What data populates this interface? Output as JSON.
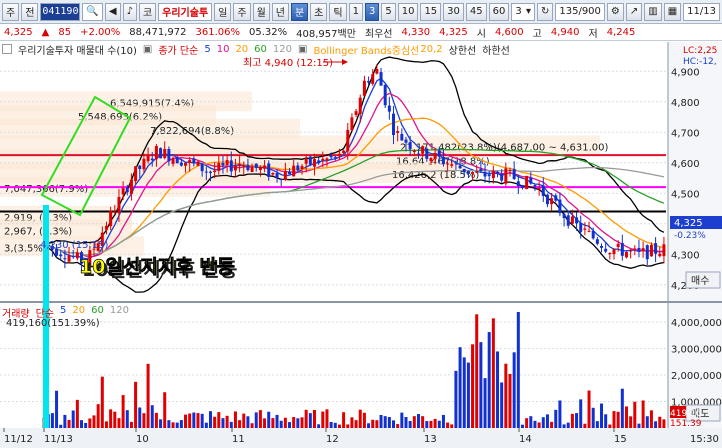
{
  "toolbar": {
    "stock_code": "041190",
    "stock_name": "우리기술투",
    "period_tabs": [
      "일",
      "주",
      "월",
      "년",
      "분",
      "초",
      "틱"
    ],
    "minute_options": [
      "1",
      "3",
      "5",
      "10",
      "15",
      "30",
      "45",
      "60"
    ],
    "selected_period": "분",
    "selected_minute": "3",
    "interval_value": "3",
    "count_display": "135/900",
    "date_label": "11/13",
    "item_labels": [
      "주",
      "전",
      "코"
    ]
  },
  "quote": {
    "price": "4,325",
    "change": "85",
    "change_pct": "+2.00%",
    "volume": "88,471,972",
    "volume_ratio": "361.06%",
    "turnover_pct": "05.32%",
    "amount": "408,957백만",
    "best_ask_label": "최우선",
    "best_ask": "4,330",
    "best_bid": "4,325",
    "open_label": "시",
    "open": "4,600",
    "high_label": "고",
    "high": "4,940",
    "low_label": "저",
    "low": "4,245"
  },
  "legend": {
    "title": "우리기술투자 매물대 수(10)",
    "ma_label": "종가 단순",
    "ma_periods": [
      "5",
      "10",
      "20",
      "60",
      "120"
    ],
    "bb_label": "Bollinger Bands중심선",
    "bb_params": "20,2",
    "upper_label": "상한선",
    "lower_label": "하한선",
    "right_top": "LC:2,25",
    "right_bottom": "HC:-12,"
  },
  "annotations": {
    "high_marker": "최고 4,940 (12:15)",
    "low_marker": "4,230 (15:15)",
    "caption": "10일선지지후 반등",
    "volume_profile": [
      {
        "text": "6,549,915(7.4%)",
        "price": 4775
      },
      {
        "text": "5,548,693(6.2%)",
        "price": 4730
      },
      {
        "text": "7,822,694(8.8%)",
        "price": 4685
      },
      {
        "text": "21,171,482(23.8%)(4,687.00 ~ 4,631.00)",
        "price": 4630
      },
      {
        "text": "16,64 ,467(18.8%)",
        "price": 4585
      },
      {
        "text": "16,426,2 (18.5%)",
        "price": 4540
      },
      {
        "text": "7,047,366(7.9%)",
        "price": 4495
      },
      {
        "text": "2,919, (3.3%)",
        "price": 4400
      },
      {
        "text": "2,967,  (3.3%)",
        "price": 4355
      },
      {
        "text": "3,(3.5%)",
        "price": 4300
      }
    ]
  },
  "right_buttons": {
    "buy": "매수",
    "sell": "매도"
  },
  "current_price_tag": {
    "value": "4,325",
    "pct": "-0.23%"
  },
  "volume_panel": {
    "title": "거래량",
    "ma_label": "단순",
    "ma_periods": [
      "5",
      "20",
      "60",
      "120"
    ],
    "value_text": "419,160",
    "value_pct": "(151.39%)",
    "right_tag": "419,16",
    "right_tag2": "151.39"
  },
  "x_axis": {
    "labels": [
      "11/12",
      "11/13",
      "10",
      "11",
      "12",
      "13",
      "14",
      "15"
    ],
    "time_label": "15:30"
  },
  "chart_data": {
    "type": "candlestick",
    "y_ticks": [
      4200,
      4300,
      4400,
      4500,
      4600,
      4700,
      4800,
      4900
    ],
    "ylim": [
      4150,
      4950
    ],
    "hlines": [
      {
        "price": 4625,
        "color": "#e0102a"
      },
      {
        "price": 4520,
        "color": "#ff00ff"
      },
      {
        "price": 4440,
        "color": "#000000"
      }
    ],
    "vol_ticks": [
      1000000,
      2000000,
      3000000,
      4000000
    ],
    "vol_max": 4600000,
    "colors": {
      "up": "#e00000",
      "down": "#1030d0",
      "ma5": "#1a3fd6",
      "ma10": "#e0148c",
      "ma20": "#ff9a00",
      "ma60": "#2aa02a",
      "ma120": "#9a9a9a",
      "bb": "#000000"
    }
  }
}
